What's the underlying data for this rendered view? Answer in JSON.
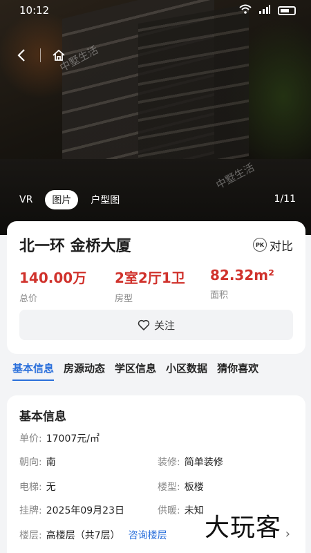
{
  "status_bar": {
    "time": "10:12"
  },
  "header": {
    "watermarks": [
      "中墅生活",
      "中墅生活"
    ]
  },
  "media": {
    "tabs": [
      {
        "label": "VR",
        "active": false
      },
      {
        "label": "图片",
        "active": true
      },
      {
        "label": "户型图",
        "active": false
      }
    ],
    "counter": "1/11"
  },
  "listing": {
    "title": "北一环 金桥大厦",
    "compare_label": "对比",
    "compare_icon": "PK",
    "stats": [
      {
        "value": "140.00万",
        "label": "总价"
      },
      {
        "value": "2室2厅1卫",
        "label": "房型"
      },
      {
        "value": "82.32m²",
        "label": "面积"
      }
    ],
    "follow_label": "关注"
  },
  "section_tabs": [
    {
      "label": "基本信息",
      "active": true
    },
    {
      "label": "房源动态",
      "active": false
    },
    {
      "label": "学区信息",
      "active": false
    },
    {
      "label": "小区数据",
      "active": false
    },
    {
      "label": "猜你喜欢",
      "active": false
    }
  ],
  "basic_info": {
    "title": "基本信息",
    "unit_price": {
      "label": "单价:",
      "value": "17007元/㎡"
    },
    "orientation": {
      "label": "朝向:",
      "value": "南"
    },
    "decoration": {
      "label": "装修:",
      "value": "简单装修"
    },
    "elevator": {
      "label": "电梯:",
      "value": "无"
    },
    "building_type": {
      "label": "楼型:",
      "value": "板楼"
    },
    "listed": {
      "label": "挂牌:",
      "value": "2025年09月23日"
    },
    "heating": {
      "label": "供暖:",
      "value": "未知"
    },
    "floor": {
      "label": "楼层:",
      "value": "高楼层（共7层）"
    },
    "consult_label": "咨询楼层"
  },
  "overlay_logo": "大玩客",
  "colors": {
    "accent": "#2a6fdb",
    "price": "#d0322c"
  }
}
